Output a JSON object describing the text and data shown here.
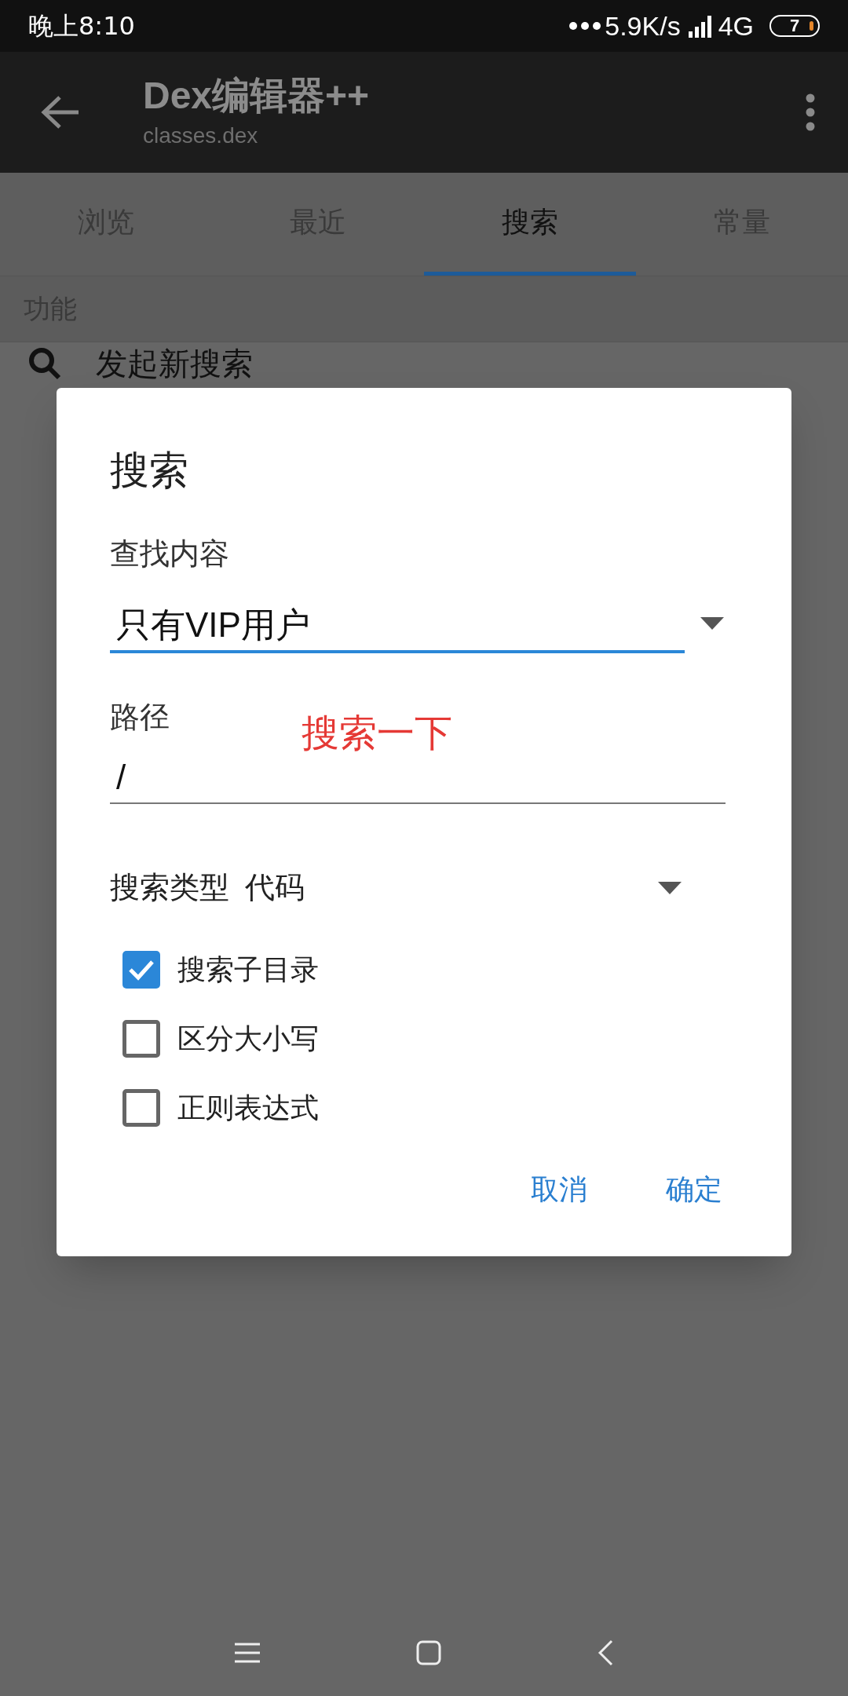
{
  "status_bar": {
    "time": "晚上8:10",
    "speed": "5.9K/s",
    "network": "4G",
    "battery": "7"
  },
  "app_bar": {
    "title": "Dex编辑器++",
    "subtitle": "classes.dex"
  },
  "tabs": [
    {
      "label": "浏览",
      "selected": false
    },
    {
      "label": "最近",
      "selected": false
    },
    {
      "label": "搜索",
      "selected": true
    },
    {
      "label": "常量",
      "selected": false
    }
  ],
  "section": {
    "header": "功能",
    "items": [
      {
        "label": "发起新搜索"
      }
    ]
  },
  "dialog": {
    "title": "搜索",
    "find_label": "查找内容",
    "find_value": "只有VIP用户",
    "path_label": "路径",
    "path_value": "/",
    "annotation": "搜索一下",
    "type_label": "搜索类型",
    "type_value": "代码",
    "options": [
      {
        "label": "搜索子目录",
        "checked": true
      },
      {
        "label": "区分大小写",
        "checked": false
      },
      {
        "label": "正则表达式",
        "checked": false
      }
    ],
    "buttons": [
      "取消",
      "确定"
    ]
  }
}
